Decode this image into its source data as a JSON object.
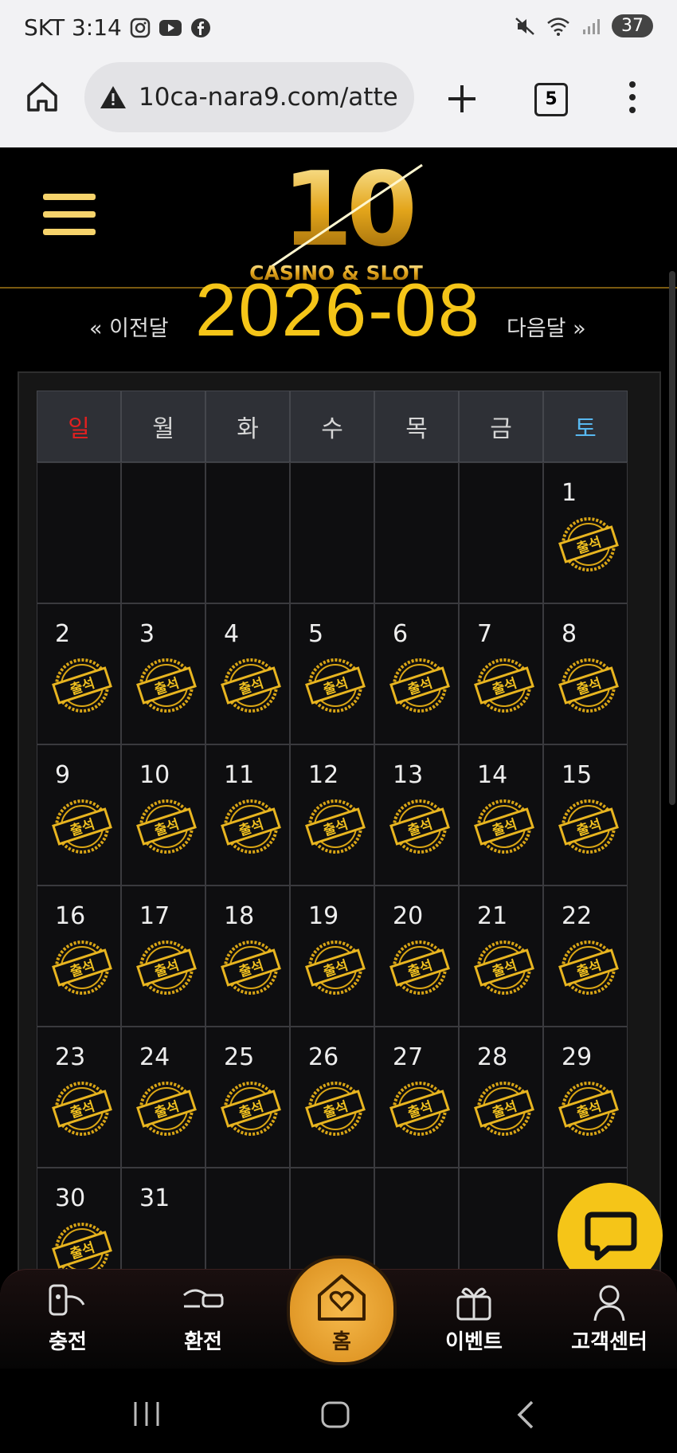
{
  "status": {
    "carrier_time": "SKT 3:14",
    "battery": "37"
  },
  "browser": {
    "url": "10ca-nara9.com/atte",
    "tab_count": "5"
  },
  "site": {
    "logo_number": "10",
    "logo_text": "CASINO & SLOT"
  },
  "calendar": {
    "month": "2026-08",
    "prev_label": "« 이전달",
    "next_label": "다음달 »",
    "weekdays": [
      "일",
      "월",
      "화",
      "수",
      "목",
      "금",
      "토"
    ],
    "stamp_text": "출석",
    "weeks": [
      [
        "",
        "",
        "",
        "",
        "",
        "",
        "1"
      ],
      [
        "2",
        "3",
        "4",
        "5",
        "6",
        "7",
        "8"
      ],
      [
        "9",
        "10",
        "11",
        "12",
        "13",
        "14",
        "15"
      ],
      [
        "16",
        "17",
        "18",
        "19",
        "20",
        "21",
        "22"
      ],
      [
        "23",
        "24",
        "25",
        "26",
        "27",
        "28",
        "29"
      ],
      [
        "30",
        "31",
        "",
        "",
        "",
        "",
        ""
      ]
    ],
    "stamped": [
      [
        false,
        false,
        false,
        false,
        false,
        false,
        true
      ],
      [
        true,
        true,
        true,
        true,
        true,
        true,
        true
      ],
      [
        true,
        true,
        true,
        true,
        true,
        true,
        true
      ],
      [
        true,
        true,
        true,
        true,
        true,
        true,
        true
      ],
      [
        true,
        true,
        true,
        true,
        true,
        true,
        true
      ],
      [
        true,
        false,
        false,
        false,
        false,
        false,
        false
      ]
    ]
  },
  "bottom_nav": {
    "charge": "충전",
    "exchange": "환전",
    "home": "홈",
    "event": "이벤트",
    "support": "고객센터"
  }
}
